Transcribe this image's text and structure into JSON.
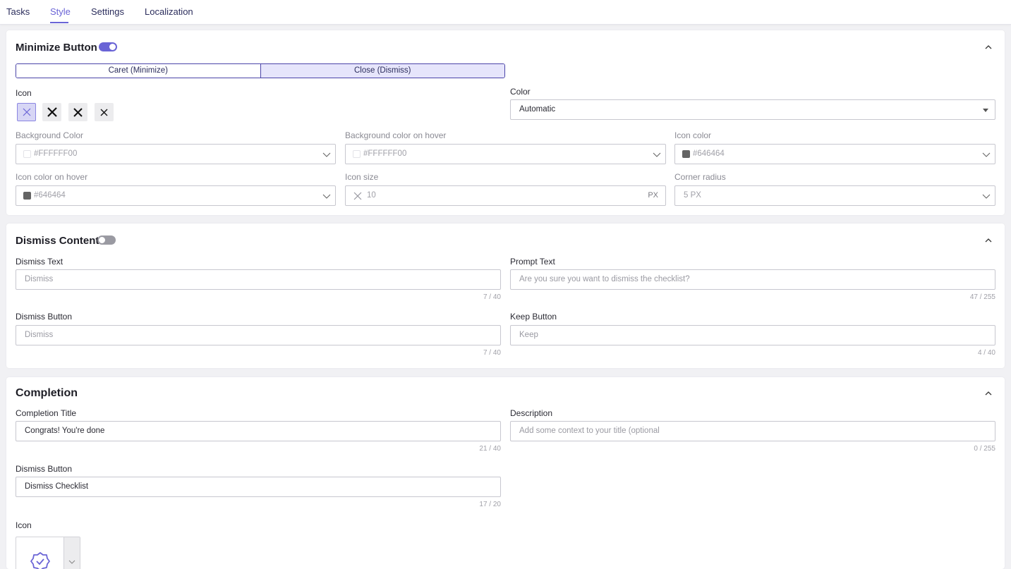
{
  "tabs": [
    {
      "label": "Tasks"
    },
    {
      "label": "Style"
    },
    {
      "label": "Settings"
    },
    {
      "label": "Localization"
    }
  ],
  "active_tab": "Style",
  "accent_color": "#6a64d6",
  "minimize": {
    "title": "Minimize Button",
    "enabled": true,
    "segments": [
      "Caret (Minimize)",
      "Close (Dismiss)"
    ],
    "selected_segment": "Close (Dismiss)",
    "icon_label": "Icon",
    "icon_options": [
      "close-thin-icon",
      "close-bold-icon",
      "close-bold-icon",
      "close-regular-icon"
    ],
    "color_label": "Color",
    "color_value": "Automatic",
    "bg_color_label": "Background Color",
    "bg_color_value": "#FFFFFF00",
    "bg_hover_label": "Background color on hover",
    "bg_hover_value": "#FFFFFF00",
    "icon_color_label": "Icon color",
    "icon_color_value": "#646464",
    "icon_hover_label": "Icon color on hover",
    "icon_hover_value": "#646464",
    "icon_size_label": "Icon size",
    "icon_size_value": "10",
    "icon_size_unit": "PX",
    "corner_label": "Corner radius",
    "corner_value": "5 PX"
  },
  "dismiss": {
    "title": "Dismiss Content",
    "enabled": false,
    "dismiss_text_label": "Dismiss Text",
    "dismiss_text_placeholder": "Dismiss",
    "dismiss_text_count": "7 / 40",
    "prompt_label": "Prompt Text",
    "prompt_placeholder": "Are you sure you want to dismiss the checklist?",
    "prompt_count": "47 / 255",
    "dismiss_button_label": "Dismiss Button",
    "dismiss_button_placeholder": "Dismiss",
    "dismiss_button_count": "7 / 40",
    "keep_label": "Keep Button",
    "keep_placeholder": "Keep",
    "keep_count": "4 / 40"
  },
  "completion": {
    "title": "Completion",
    "title_label": "Completion Title",
    "title_value": "Congrats! You're done",
    "title_count": "21 / 40",
    "description_label": "Description",
    "description_placeholder": "Add some context to your title (optional",
    "description_count": "0 / 255",
    "dismiss_button_label": "Dismiss Button",
    "dismiss_button_value": "Dismiss Checklist",
    "dismiss_button_count": "17 / 20",
    "icon_label": "Icon",
    "icon_value": "verified-badge-icon"
  }
}
